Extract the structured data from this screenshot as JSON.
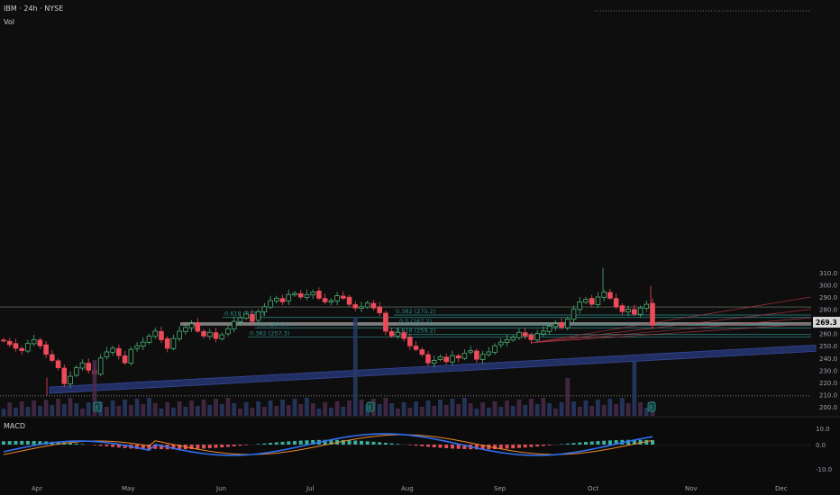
{
  "header": {
    "symbol": "IBM · 24h · NYSE",
    "volume_label": "Vol"
  },
  "macd_label": "MACD",
  "price_badge": "269.3",
  "colors": {
    "up": "#4caf75",
    "down": "#ef4a5a",
    "trend": "#24336e",
    "zone": "#d9d9d9",
    "fib": "#2a8f8a",
    "macd": "#2f6ff2",
    "signal": "#f08a2a",
    "bg": "#0e0e0e"
  },
  "chart_data": {
    "type": "candlestick",
    "y_axis": {
      "ticks": [
        200,
        210,
        220,
        230,
        240,
        250,
        260,
        270,
        280,
        290,
        300,
        310
      ],
      "range": [
        197,
        317
      ]
    },
    "x_axis": {
      "labels": [
        "Apr",
        "May",
        "Jun",
        "Jul",
        "Aug",
        "Sep",
        "Oct",
        "Nov",
        "Dec"
      ]
    },
    "closes": [
      254,
      251,
      248,
      246,
      252,
      255,
      250,
      243,
      238,
      232,
      219,
      225,
      232,
      236,
      230,
      227,
      240,
      245,
      248,
      242,
      236,
      247,
      250,
      253,
      258,
      262,
      255,
      248,
      256,
      262,
      265,
      268,
      262,
      258,
      261,
      256,
      259,
      264,
      270,
      273,
      276,
      270,
      278,
      282,
      287,
      289,
      286,
      292,
      293,
      290,
      292,
      294,
      289,
      286,
      287,
      291,
      289,
      284,
      281,
      282,
      285,
      281,
      277,
      262,
      258,
      261,
      256,
      250,
      247,
      243,
      236,
      238,
      241,
      237,
      242,
      240,
      244,
      246,
      239,
      243,
      245,
      250,
      253,
      255,
      257,
      261,
      258,
      255,
      260,
      262,
      266,
      268,
      265,
      272,
      280,
      286,
      288,
      284,
      290,
      294,
      289,
      282,
      278,
      280,
      276,
      281,
      284,
      267
    ],
    "fib_levels": [
      {
        "label": "0.618 (273.2)",
        "value": 273.2
      },
      {
        "label": "0.382 (275.2)",
        "value": 275.2
      },
      {
        "label": "0.5 (264.7)",
        "value": 264.7
      },
      {
        "label": "0.5 (267.2)",
        "value": 267.2
      },
      {
        "label": "0.618 (259.2)",
        "value": 259.2
      },
      {
        "label": "0.382 (257.3)",
        "value": 257.3
      }
    ],
    "horizontal_levels": [
      281.8,
      209
    ],
    "zone": [
      266.5,
      269.3
    ],
    "volume_max_ratio": 1.0,
    "macd_ticks": [
      "10.0",
      "0.0",
      "-10.0"
    ],
    "earnings_marker": "E"
  }
}
